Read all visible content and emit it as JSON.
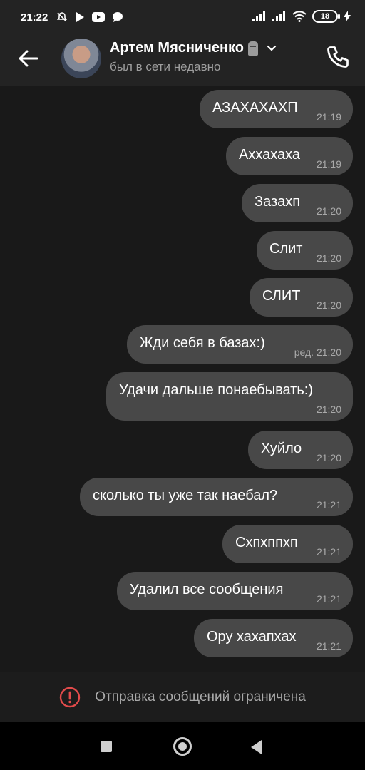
{
  "status_bar": {
    "time": "21:22",
    "battery": "18",
    "icons": [
      "mute-icon",
      "play-icon",
      "youtube-icon",
      "chat-icon",
      "signal-icon",
      "signal-icon",
      "wifi-icon",
      "battery-icon",
      "charging-icon"
    ]
  },
  "header": {
    "contact_name": "Артем Мясниченко",
    "status": "был в сети недавно"
  },
  "messages": [
    {
      "text": "АЗАХАХАХП",
      "time": "21:19"
    },
    {
      "text": "Аххахаха",
      "time": "21:19"
    },
    {
      "text": "Зазахп",
      "time": "21:20"
    },
    {
      "text": "Слит",
      "time": "21:20"
    },
    {
      "text": "СЛИТ",
      "time": "21:20"
    },
    {
      "text": "Жди себя в базах:)",
      "time": "ред. 21:20"
    },
    {
      "text": "Удачи дальше понаебывать:)",
      "time": "21:20"
    },
    {
      "text": "Хуйло",
      "time": "21:20"
    },
    {
      "text": "сколько ты уже так наебал?",
      "time": "21:21"
    },
    {
      "text": "Схпхппхп",
      "time": "21:21"
    },
    {
      "text": "Удалил все сообщения",
      "time": "21:21"
    },
    {
      "text": "Ору хахапхах",
      "time": "21:21"
    }
  ],
  "restricted_notice": "Отправка сообщений ограничена",
  "colors": {
    "background": "#191919",
    "header": "#232323",
    "bubble": "#484848",
    "warning": "#e24b4b"
  }
}
